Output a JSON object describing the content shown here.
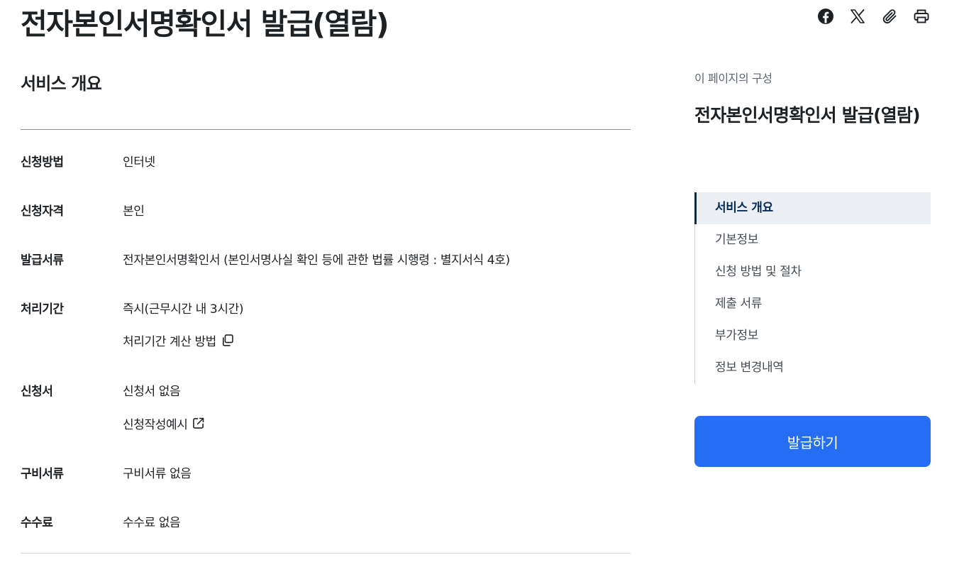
{
  "page": {
    "title": "전자본인서명확인서 발급(열람)"
  },
  "share": {
    "icons": [
      "facebook-icon",
      "x-icon",
      "paperclip-icon",
      "print-icon"
    ]
  },
  "overview": {
    "title": "서비스 개요",
    "rows": [
      {
        "label": "신청방법",
        "value": "인터넷"
      },
      {
        "label": "신청자격",
        "value": "본인"
      },
      {
        "label": "발급서류",
        "value": "전자본인서명확인서 (본인서명사실 확인 등에 관한 법률 시행령 : 별지서식 4호)"
      },
      {
        "label": "처리기간",
        "value": "즉시(근무시간 내 3시간)",
        "link": "처리기간 계산 방법"
      },
      {
        "label": "신청서",
        "value": "신청서 없음",
        "link": "신청작성예시"
      },
      {
        "label": "구비서류",
        "value": "구비서류 없음"
      },
      {
        "label": "수수료",
        "value": "수수료 없음"
      }
    ]
  },
  "toc": {
    "caption": "이 페이지의 구성",
    "title": "전자본인서명확인서 발급(열람)",
    "items": [
      "서비스 개요",
      "기본정보",
      "신청 방법 및 절차",
      "제출 서류",
      "부가정보",
      "정보 변경내역"
    ],
    "active_index": 0
  },
  "action": {
    "issue_label": "발급하기",
    "color": "#256ef4"
  }
}
